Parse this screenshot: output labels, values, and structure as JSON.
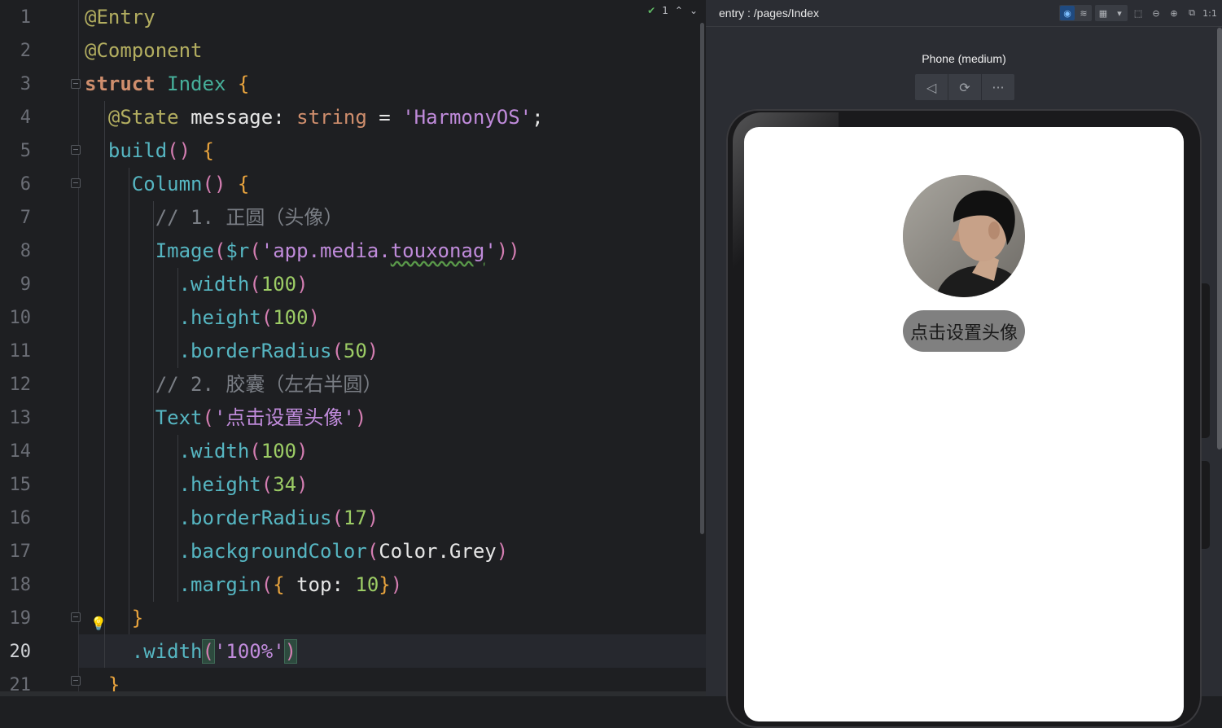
{
  "editor": {
    "lines": [
      "1",
      "2",
      "3",
      "4",
      "5",
      "6",
      "7",
      "8",
      "9",
      "10",
      "11",
      "12",
      "13",
      "14",
      "15",
      "16",
      "17",
      "18",
      "19",
      "20",
      "21"
    ],
    "current_line": "20",
    "inspection_count": "1",
    "code": {
      "l1": "@Entry",
      "l2": "@Component",
      "l3_kw": "struct",
      "l3_name": "Index",
      "l4_ann": "@State",
      "l4_var": "message",
      "l4_type": "string",
      "l4_str": "'HarmonyOS'",
      "l5_fn": "build",
      "l6_fn": "Column",
      "l7_cmt": "// 1. 正圆（头像）",
      "l8_fn": "Image",
      "l8_res": "$r",
      "l8_str_pre": "'app.media.",
      "l8_str_typo": "touxonag",
      "l8_str_post": "'",
      "l9_fn": ".width",
      "l9_num": "100",
      "l10_fn": ".height",
      "l10_num": "100",
      "l11_fn": ".borderRadius",
      "l11_num": "50",
      "l12_cmt": "// 2. 胶囊（左右半圆）",
      "l13_fn": "Text",
      "l13_str": "'点击设置头像'",
      "l14_fn": ".width",
      "l14_num": "100",
      "l15_fn": ".height",
      "l15_num": "34",
      "l16_fn": ".borderRadius",
      "l16_num": "17",
      "l17_fn": ".backgroundColor",
      "l17_arg": "Color.Grey",
      "l18_fn": ".margin",
      "l18_key": "top",
      "l18_num": "10",
      "l20_fn": ".width",
      "l20_str": "'100%'"
    }
  },
  "previewer": {
    "path": "entry : /pages/Index",
    "device": "Phone (medium)",
    "nav": {
      "back": "◁",
      "rotate": "⟳",
      "more": "···"
    },
    "app": {
      "button_label": "点击设置头像"
    }
  },
  "colors": {
    "editor_bg": "#1e1f22",
    "previewer_bg": "#2b2d33",
    "capsule_grey": "#808080"
  }
}
